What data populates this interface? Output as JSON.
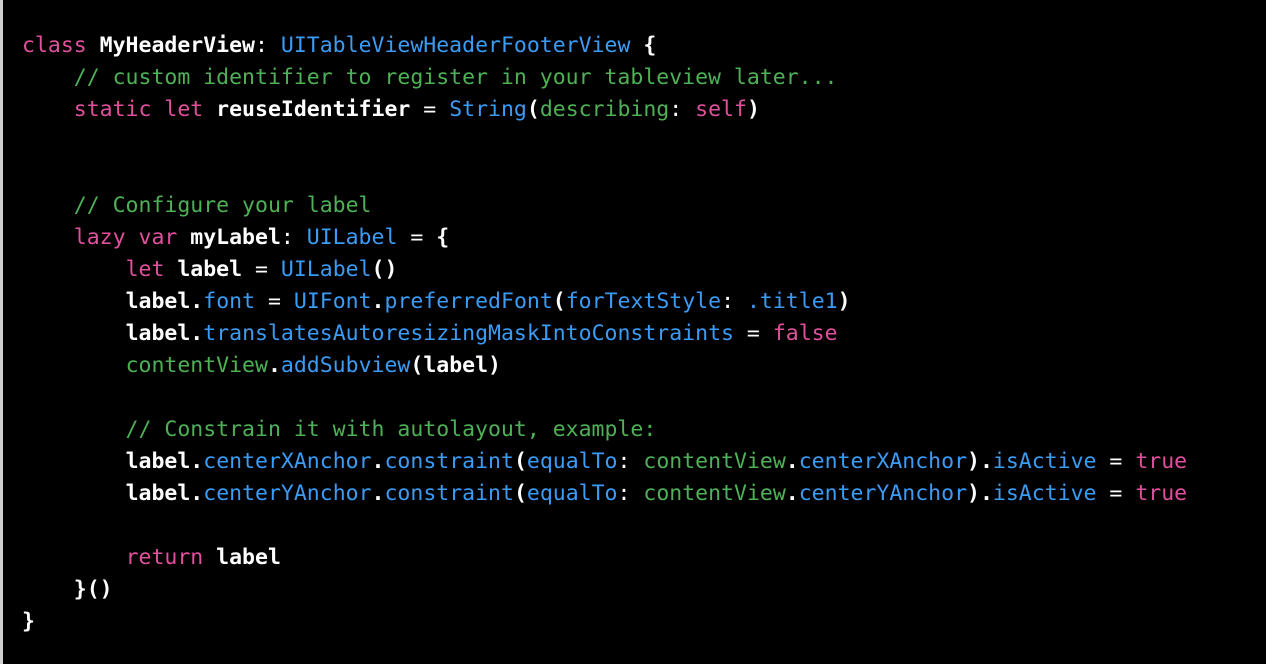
{
  "editor": {
    "name": "swift-code-snippet",
    "language": "Swift",
    "background_color": "#000000",
    "theme_colors": {
      "keyword_pink": "#e0509d",
      "type_blue": "#3b9cf5",
      "comment_green": "#4eb155",
      "identifier_green": "#4eb155",
      "plain_white": "#ffffff",
      "left_edge_gray": "#cfcfcf"
    },
    "full_text": "class MyHeaderView: UITableViewHeaderFooterView {\n    // custom identifier to register in your tableview later...\n    static let reuseIdentifier = String(describing: self)\n\n\n    // Configure your label\n    lazy var myLabel: UILabel = {\n        let label = UILabel()\n        label.font = UIFont.preferredFont(forTextStyle: .title1)\n        label.translatesAutoresizingMaskIntoConstraints = false\n        contentView.addSubview(label)\n\n        // Constrain it with autolayout, example:\n        label.centerXAnchor.constraint(equalTo: contentView.centerXAnchor).isActive = true\n        label.centerYAnchor.constraint(equalTo: contentView.centerYAnchor).isActive = true\n\n        return label\n    }()\n}"
  },
  "lines": [
    {
      "n": 1,
      "tokens": [
        {
          "t": "class ",
          "c": "tok-kw"
        },
        {
          "t": "MyHeaderView",
          "c": "tok-pln"
        },
        {
          "t": ": ",
          "c": "tok-op"
        },
        {
          "t": "UITableViewHeaderFooterView",
          "c": "tok-type"
        },
        {
          "t": " ",
          "c": "tok-op"
        },
        {
          "t": "{",
          "c": "tok-pln"
        }
      ]
    },
    {
      "n": 2,
      "tokens": [
        {
          "t": "    // custom identifier to register in your tableview later...",
          "c": "tok-com"
        }
      ]
    },
    {
      "n": 3,
      "tokens": [
        {
          "t": "    ",
          "c": "tok-op"
        },
        {
          "t": "static let ",
          "c": "tok-kw"
        },
        {
          "t": "reuseIdentifier",
          "c": "tok-pln"
        },
        {
          "t": " = ",
          "c": "tok-op"
        },
        {
          "t": "String",
          "c": "tok-type"
        },
        {
          "t": "(",
          "c": "tok-pln"
        },
        {
          "t": "describing",
          "c": "tok-id"
        },
        {
          "t": ": ",
          "c": "tok-op"
        },
        {
          "t": "self",
          "c": "tok-kw"
        },
        {
          "t": ")",
          "c": "tok-pln"
        }
      ]
    },
    {
      "n": 4,
      "tokens": [
        {
          "t": "",
          "c": "tok-op"
        }
      ]
    },
    {
      "n": 5,
      "tokens": [
        {
          "t": "",
          "c": "tok-op"
        }
      ]
    },
    {
      "n": 6,
      "tokens": [
        {
          "t": "    // Configure your label",
          "c": "tok-com"
        }
      ]
    },
    {
      "n": 7,
      "tokens": [
        {
          "t": "    ",
          "c": "tok-op"
        },
        {
          "t": "lazy var ",
          "c": "tok-kw"
        },
        {
          "t": "myLabel",
          "c": "tok-pln"
        },
        {
          "t": ": ",
          "c": "tok-op"
        },
        {
          "t": "UILabel",
          "c": "tok-type"
        },
        {
          "t": " = ",
          "c": "tok-op"
        },
        {
          "t": "{",
          "c": "tok-pln"
        }
      ]
    },
    {
      "n": 8,
      "tokens": [
        {
          "t": "        ",
          "c": "tok-op"
        },
        {
          "t": "let ",
          "c": "tok-kw"
        },
        {
          "t": "label",
          "c": "tok-pln"
        },
        {
          "t": " = ",
          "c": "tok-op"
        },
        {
          "t": "UILabel",
          "c": "tok-type"
        },
        {
          "t": "()",
          "c": "tok-pln"
        }
      ]
    },
    {
      "n": 9,
      "tokens": [
        {
          "t": "        ",
          "c": "tok-op"
        },
        {
          "t": "label",
          "c": "tok-pln"
        },
        {
          "t": ".",
          "c": "tok-pln"
        },
        {
          "t": "font",
          "c": "tok-type"
        },
        {
          "t": " = ",
          "c": "tok-op"
        },
        {
          "t": "UIFont",
          "c": "tok-type"
        },
        {
          "t": ".",
          "c": "tok-pln"
        },
        {
          "t": "preferredFont",
          "c": "tok-type"
        },
        {
          "t": "(",
          "c": "tok-pln"
        },
        {
          "t": "forTextStyle",
          "c": "tok-type"
        },
        {
          "t": ": ",
          "c": "tok-op"
        },
        {
          "t": ".title1",
          "c": "tok-type"
        },
        {
          "t": ")",
          "c": "tok-pln"
        }
      ]
    },
    {
      "n": 10,
      "tokens": [
        {
          "t": "        ",
          "c": "tok-op"
        },
        {
          "t": "label",
          "c": "tok-pln"
        },
        {
          "t": ".",
          "c": "tok-pln"
        },
        {
          "t": "translatesAutoresizingMaskIntoConstraints",
          "c": "tok-type"
        },
        {
          "t": " = ",
          "c": "tok-op"
        },
        {
          "t": "false",
          "c": "tok-kw"
        }
      ]
    },
    {
      "n": 11,
      "tokens": [
        {
          "t": "        ",
          "c": "tok-op"
        },
        {
          "t": "contentView",
          "c": "tok-id"
        },
        {
          "t": ".",
          "c": "tok-pln"
        },
        {
          "t": "addSubview",
          "c": "tok-type"
        },
        {
          "t": "(",
          "c": "tok-pln"
        },
        {
          "t": "label",
          "c": "tok-pln"
        },
        {
          "t": ")",
          "c": "tok-pln"
        }
      ]
    },
    {
      "n": 12,
      "tokens": [
        {
          "t": "",
          "c": "tok-op"
        }
      ]
    },
    {
      "n": 13,
      "tokens": [
        {
          "t": "        // Constrain it with autolayout, example:",
          "c": "tok-com"
        }
      ]
    },
    {
      "n": 14,
      "tokens": [
        {
          "t": "        ",
          "c": "tok-op"
        },
        {
          "t": "label",
          "c": "tok-pln"
        },
        {
          "t": ".",
          "c": "tok-pln"
        },
        {
          "t": "centerXAnchor",
          "c": "tok-type"
        },
        {
          "t": ".",
          "c": "tok-pln"
        },
        {
          "t": "constraint",
          "c": "tok-type"
        },
        {
          "t": "(",
          "c": "tok-pln"
        },
        {
          "t": "equalTo",
          "c": "tok-type"
        },
        {
          "t": ": ",
          "c": "tok-op"
        },
        {
          "t": "contentView",
          "c": "tok-id"
        },
        {
          "t": ".",
          "c": "tok-pln"
        },
        {
          "t": "centerXAnchor",
          "c": "tok-type"
        },
        {
          "t": ")",
          "c": "tok-pln"
        },
        {
          "t": ".",
          "c": "tok-pln"
        },
        {
          "t": "isActive",
          "c": "tok-type"
        },
        {
          "t": " = ",
          "c": "tok-op"
        },
        {
          "t": "true",
          "c": "tok-kw"
        }
      ]
    },
    {
      "n": 15,
      "tokens": [
        {
          "t": "        ",
          "c": "tok-op"
        },
        {
          "t": "label",
          "c": "tok-pln"
        },
        {
          "t": ".",
          "c": "tok-pln"
        },
        {
          "t": "centerYAnchor",
          "c": "tok-type"
        },
        {
          "t": ".",
          "c": "tok-pln"
        },
        {
          "t": "constraint",
          "c": "tok-type"
        },
        {
          "t": "(",
          "c": "tok-pln"
        },
        {
          "t": "equalTo",
          "c": "tok-type"
        },
        {
          "t": ": ",
          "c": "tok-op"
        },
        {
          "t": "contentView",
          "c": "tok-id"
        },
        {
          "t": ".",
          "c": "tok-pln"
        },
        {
          "t": "centerYAnchor",
          "c": "tok-type"
        },
        {
          "t": ")",
          "c": "tok-pln"
        },
        {
          "t": ".",
          "c": "tok-pln"
        },
        {
          "t": "isActive",
          "c": "tok-type"
        },
        {
          "t": " = ",
          "c": "tok-op"
        },
        {
          "t": "true",
          "c": "tok-kw"
        }
      ]
    },
    {
      "n": 16,
      "tokens": [
        {
          "t": "",
          "c": "tok-op"
        }
      ]
    },
    {
      "n": 17,
      "tokens": [
        {
          "t": "        ",
          "c": "tok-op"
        },
        {
          "t": "return ",
          "c": "tok-kw"
        },
        {
          "t": "label",
          "c": "tok-pln"
        }
      ]
    },
    {
      "n": 18,
      "tokens": [
        {
          "t": "    ",
          "c": "tok-op"
        },
        {
          "t": "}()",
          "c": "tok-pln"
        }
      ]
    },
    {
      "n": 19,
      "tokens": [
        {
          "t": "}",
          "c": "tok-pln"
        }
      ]
    }
  ]
}
